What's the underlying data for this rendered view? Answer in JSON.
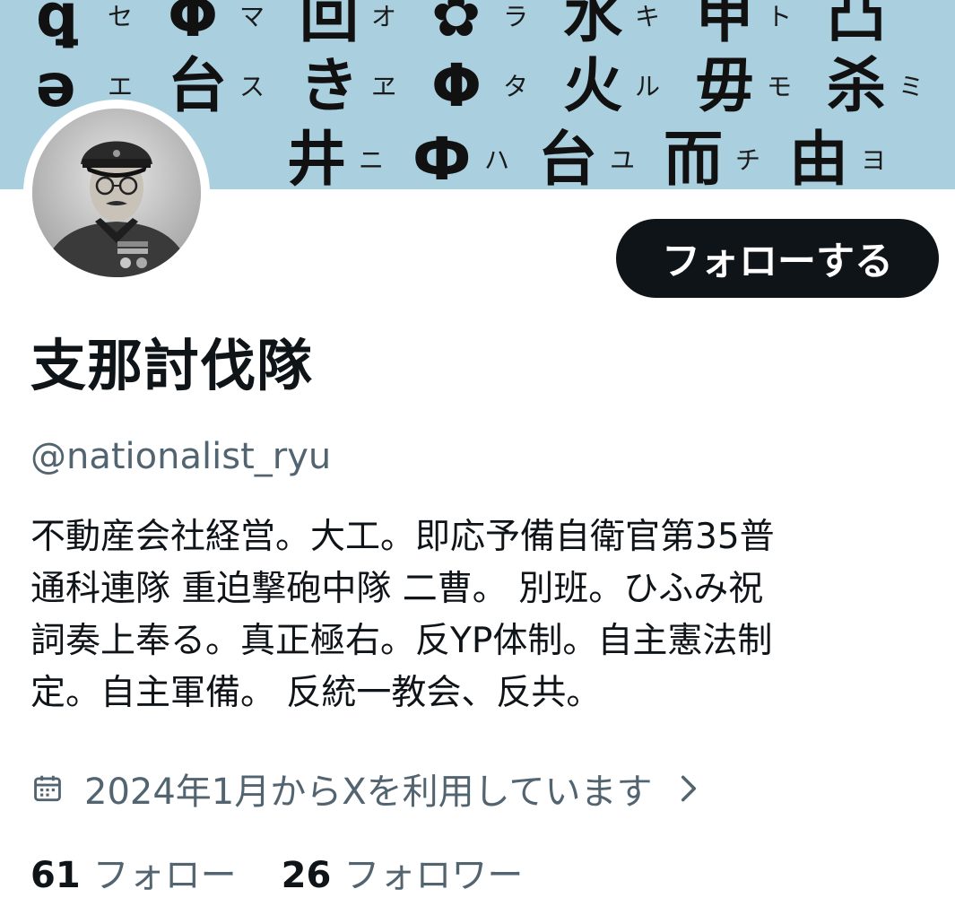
{
  "banner": {
    "background": "#aacfdf",
    "rows": [
      [
        {
          "glyph": "ꝗ",
          "kana": "セ"
        },
        {
          "glyph": "Φ",
          "kana": "マ"
        },
        {
          "glyph": "回",
          "kana": "オ"
        },
        {
          "glyph": "✿",
          "kana": "ラ"
        },
        {
          "glyph": "水",
          "kana": "キ"
        },
        {
          "glyph": "甲",
          "kana": "ト"
        },
        {
          "glyph": "凸",
          "kana": ""
        }
      ],
      [
        {
          "glyph": "ə",
          "kana": "エ"
        },
        {
          "glyph": "台",
          "kana": "ス"
        },
        {
          "glyph": "き",
          "kana": "ヱ"
        },
        {
          "glyph": "Φ",
          "kana": "タ"
        },
        {
          "glyph": "火",
          "kana": "ル"
        },
        {
          "glyph": "毋",
          "kana": "モ"
        },
        {
          "glyph": "杀",
          "kana": "ミ"
        }
      ],
      [
        {
          "glyph": "井",
          "kana": "ニ"
        },
        {
          "glyph": "Ф",
          "kana": "ハ"
        },
        {
          "glyph": "台",
          "kana": "ユ"
        },
        {
          "glyph": "而",
          "kana": "チ"
        },
        {
          "glyph": "由",
          "kana": "ヨ"
        }
      ]
    ]
  },
  "profile": {
    "display_name": "支那討伐隊",
    "handle": "@nationalist_ryu",
    "bio": "不動産会社経営。大工。即応予備自衛官第35普\n通科連隊 重迫撃砲中隊 二曹。 別班。ひふみ祝\n詞奏上奉る。真正極右。反YP体制。自主憲法制\n定。自主軍備。 反統一教会、反共。",
    "joined": "2024年1月からXを利用しています"
  },
  "actions": {
    "follow_label": "フォローする"
  },
  "stats": {
    "following_count": "61",
    "following_label": "フォロー",
    "followers_count": "26",
    "followers_label": "フォロワー"
  },
  "icons": {
    "calendar": "calendar-icon",
    "chevron": "chevron-right-icon"
  },
  "colors": {
    "text": "#0f1419",
    "secondary": "#536471",
    "button_bg": "#0f1419",
    "button_text": "#ffffff"
  }
}
